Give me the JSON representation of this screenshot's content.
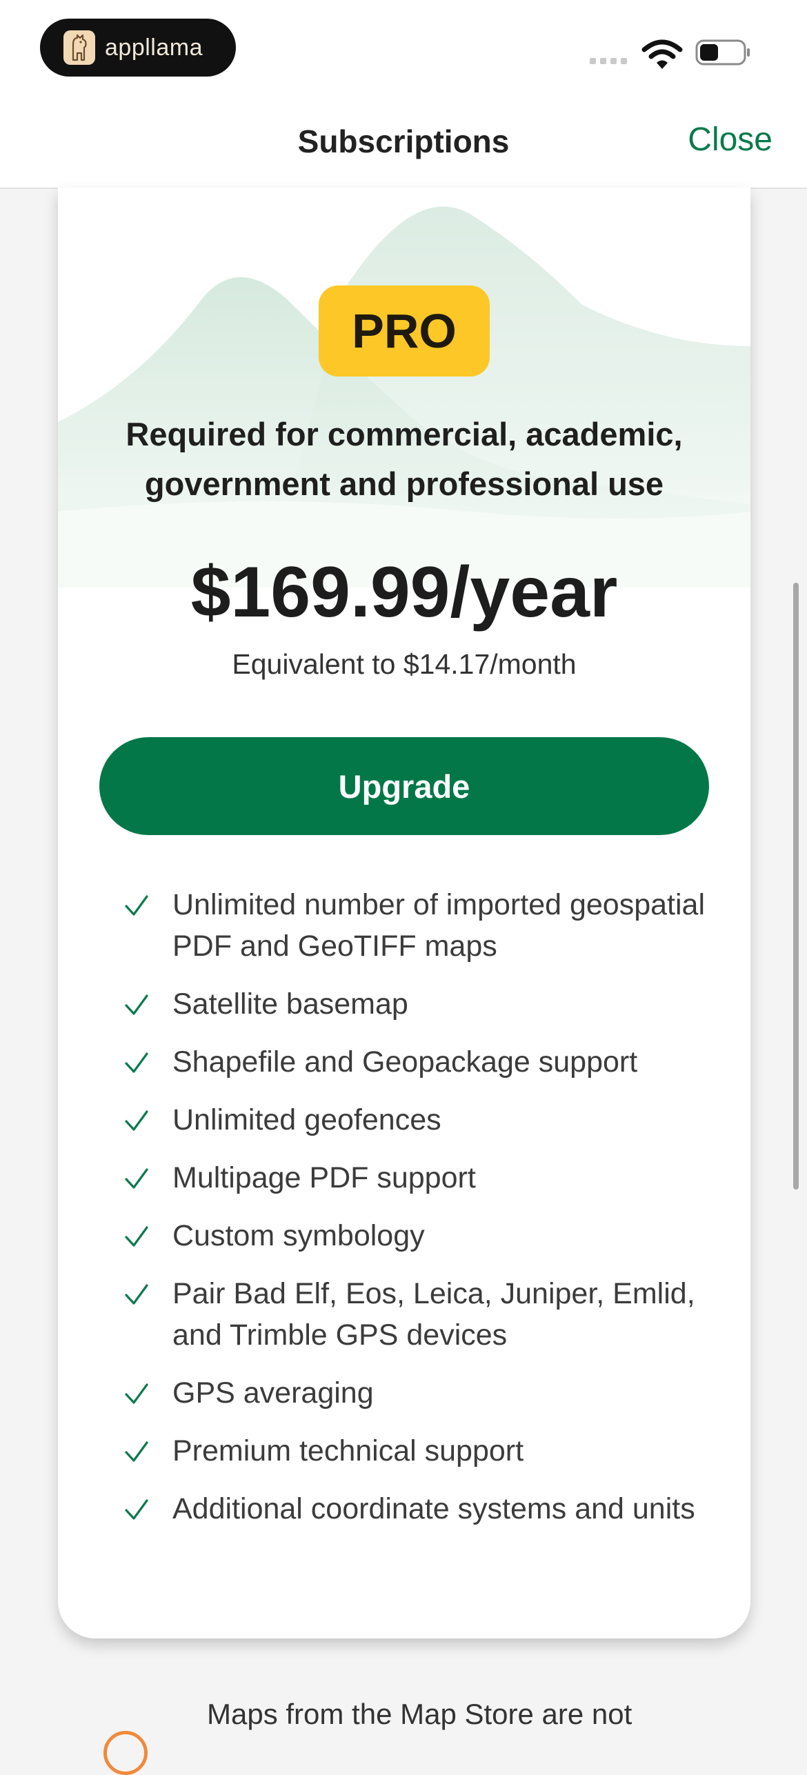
{
  "status_bar": {
    "brand": "appllama"
  },
  "header": {
    "title": "Subscriptions",
    "close_label": "Close"
  },
  "plan": {
    "badge": "PRO",
    "tagline": "Required for commercial, academic, government and professional use",
    "price": "$169.99/year",
    "equivalent": "Equivalent to $14.17/month",
    "upgrade_label": "Upgrade",
    "features": [
      "Unlimited number of imported geospatial PDF and GeoTIFF maps",
      "Satellite basemap",
      "Shapefile and Geopackage support",
      "Unlimited geofences",
      "Multipage PDF support",
      "Custom symbology",
      "Pair Bad Elf, Eos, Leica, Juniper, Emlid, and Trimble GPS devices",
      "GPS averaging",
      "Premium technical support",
      "Additional coordinate systems and units"
    ]
  },
  "footer": {
    "note": "Maps from the Map Store are not"
  },
  "colors": {
    "accent": "#037748",
    "badge": "#fcc727",
    "close": "#0b7a4b"
  },
  "icons": {
    "check": "check-icon",
    "wifi": "wifi-icon",
    "battery": "battery-icon"
  }
}
